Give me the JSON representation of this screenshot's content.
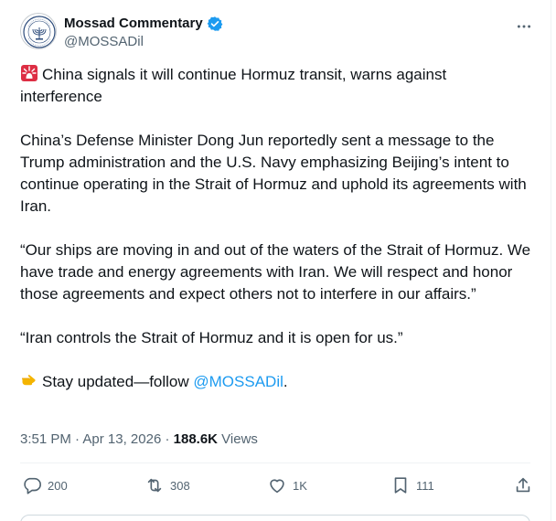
{
  "author": {
    "display_name": "Mossad Commentary",
    "handle": "@MOSSADil",
    "avatar_icon": "mossad-emblem-icon",
    "verified_icon": "verified-badge-icon",
    "verified_color": "#1d9bf0"
  },
  "tweet": {
    "paragraphs": [
      {
        "emoji": "rotating-light-icon",
        "text": "China signals it will continue Hormuz transit, warns against interference"
      },
      {
        "text": "China’s Defense Minister Dong Jun reportedly sent a message to the Trump administration and the U.S. Navy emphasizing Beijing’s intent to continue operating in the Strait of Hormuz and uphold its agreements with Iran."
      },
      {
        "text": "“Our ships are moving in and out of the waters of the Strait of Hormuz. We have trade and energy agreements with Iran. We will respect and honor those agreements and expect others not to interfere in our affairs.”"
      },
      {
        "text": "“Iran controls the Strait of Hormuz and it is open for us.”"
      }
    ],
    "cta": {
      "emoji": "pointing-right-icon",
      "text": "Stay updated—follow ",
      "mention": "@MOSSADil",
      "suffix": "."
    }
  },
  "meta": {
    "time": "3:51 PM",
    "separator": " · ",
    "date": "Apr 13, 2026",
    "views_count": "188.6K",
    "views_label": " Views"
  },
  "actions": {
    "replies": "200",
    "reposts": "308",
    "likes": "1K",
    "bookmarks": "111"
  },
  "colors": {
    "text": "#0f1419",
    "muted": "#536471",
    "accent": "#1d9bf0",
    "divider": "#eff3f4"
  }
}
